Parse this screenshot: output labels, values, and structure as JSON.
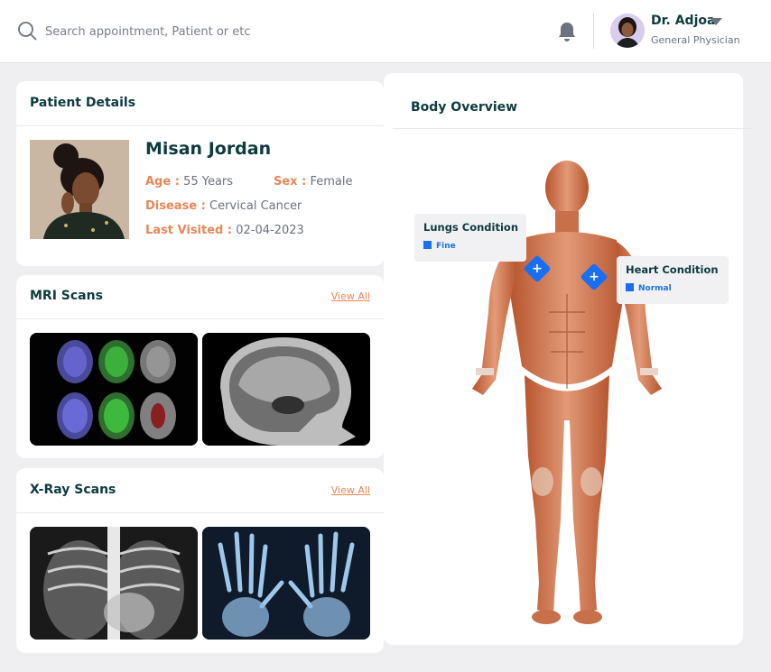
{
  "header": {
    "search_placeholder": "Search appointment, Patient or etc",
    "doctor_name": "Dr. Adjoa",
    "doctor_role": "General Physician"
  },
  "patient": {
    "section_title": "Patient Details",
    "name": "Misan Jordan",
    "age_label": "Age :",
    "age_value": "55 Years",
    "sex_label": "Sex :",
    "sex_value": "Female",
    "disease_label": "Disease :",
    "disease_value": "Cervical Cancer",
    "last_visited_label": "Last Visited :",
    "last_visited_value": "02-04-2023"
  },
  "mri": {
    "title": "MRI Scans",
    "view_all": "View All"
  },
  "xray": {
    "title": "X-Ray Scans",
    "view_all": "View All"
  },
  "body_overview": {
    "title": "Body Overview",
    "lungs": {
      "title": "Lungs Condition",
      "status": "Fine"
    },
    "heart": {
      "title": "Heart Condition",
      "status": "Normal"
    },
    "marker_symbol": "+"
  },
  "colors": {
    "brand_dark": "#0e3b3f",
    "accent_orange": "#e8875a",
    "accent_blue": "#1a6ff0",
    "background": "#efeff2"
  },
  "icons": [
    "search-icon",
    "bell-icon",
    "chevron-down-icon"
  ]
}
